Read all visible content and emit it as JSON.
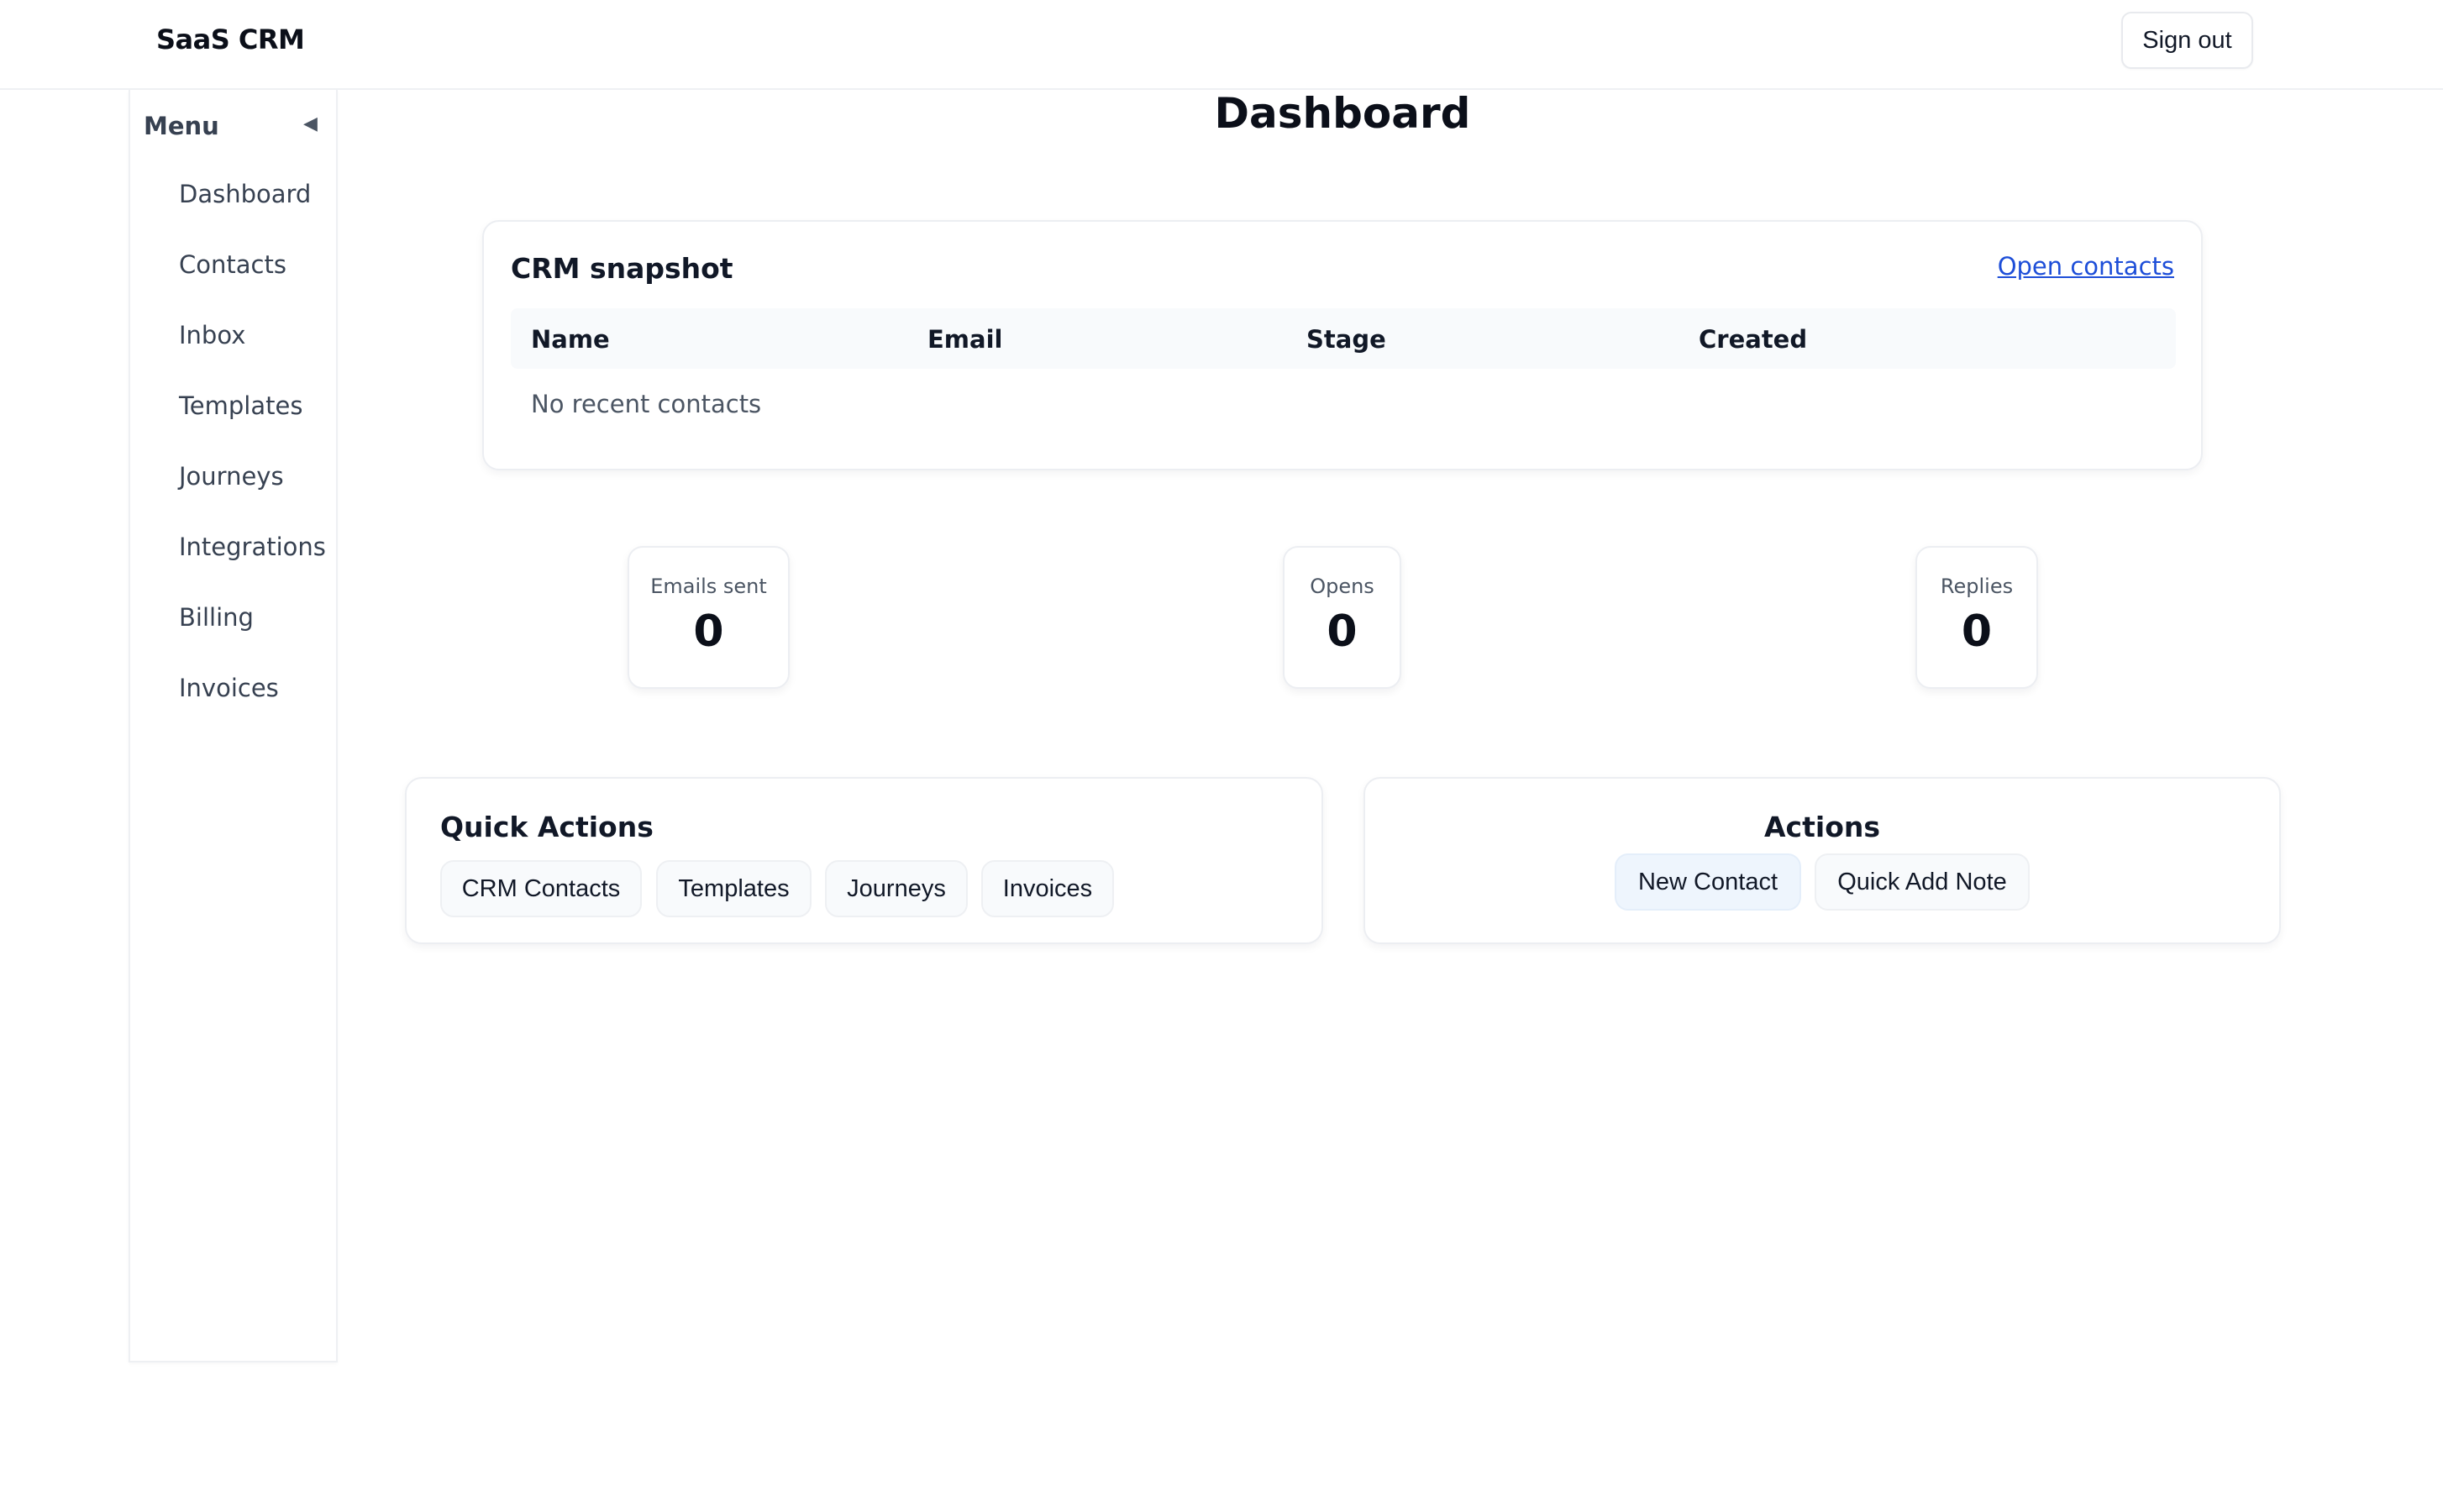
{
  "header": {
    "brand": "SaaS CRM",
    "sign_out_label": "Sign out"
  },
  "sidebar": {
    "menu_title": "Menu",
    "toggle_glyph": "◀",
    "items": [
      {
        "label": "Dashboard"
      },
      {
        "label": "Contacts"
      },
      {
        "label": "Inbox"
      },
      {
        "label": "Templates"
      },
      {
        "label": "Journeys"
      },
      {
        "label": "Integrations"
      },
      {
        "label": "Billing"
      },
      {
        "label": "Invoices"
      }
    ]
  },
  "main": {
    "title": "Dashboard",
    "snapshot": {
      "title": "CRM snapshot",
      "link_label": "Open contacts",
      "columns": [
        "Name",
        "Email",
        "Stage",
        "Created"
      ],
      "empty_text": "No recent contacts"
    },
    "stats": [
      {
        "label": "Emails sent",
        "value": "0"
      },
      {
        "label": "Opens",
        "value": "0"
      },
      {
        "label": "Replies",
        "value": "0"
      }
    ],
    "quick_actions": {
      "title": "Quick Actions",
      "buttons": [
        "CRM Contacts",
        "Templates",
        "Journeys",
        "Invoices"
      ]
    },
    "actions": {
      "title": "Actions",
      "buttons": [
        "New Contact",
        "Quick Add Note"
      ]
    }
  },
  "colors": {
    "link": "#1d4ed8",
    "primary_chip_bg": "#eef5fd",
    "chip_bg": "#f8fafc",
    "border": "#eceef2"
  }
}
